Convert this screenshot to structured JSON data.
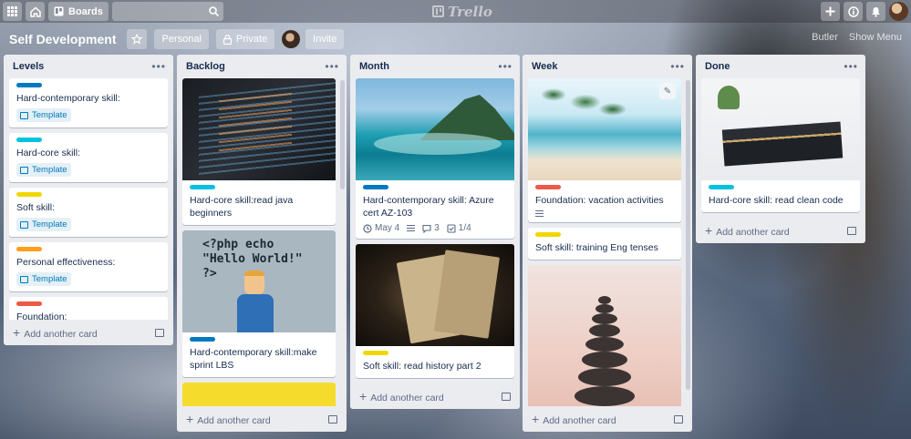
{
  "topbar": {
    "boards_label": "Boards",
    "logo_text": "Trello"
  },
  "board": {
    "title": "Self Development",
    "visibility_team": "Personal",
    "visibility_private": "Private",
    "invite_label": "Invite",
    "right_items": [
      "Butler",
      "Show Menu"
    ]
  },
  "colors": {
    "blue": "#0079bf",
    "sky": "#00c2e0",
    "yellow": "#f2d600",
    "orange": "#ff9f1a",
    "red": "#eb5a46"
  },
  "common": {
    "add_card_label": "Add another card",
    "template_badge": "Template"
  },
  "lists": {
    "levels": {
      "title": "Levels",
      "cards": [
        {
          "title": "Hard-contemporary skill:",
          "label_color": "blue"
        },
        {
          "title": "Hard-core skill:",
          "label_color": "sky"
        },
        {
          "title": "Soft skill:",
          "label_color": "yellow"
        },
        {
          "title": "Personal effectiveness:",
          "label_color": "orange"
        },
        {
          "title": "Foundation:",
          "label_color": "red"
        }
      ]
    },
    "backlog": {
      "title": "Backlog",
      "cards": [
        {
          "title": "Hard-core skill:read java beginners",
          "label_color": "sky"
        },
        {
          "title": "Hard-contemporary skill:make sprint LBS",
          "label_color": "blue"
        }
      ],
      "cover_text": [
        "<?php echo",
        "\"Hello World!\"",
        "?>"
      ]
    },
    "month": {
      "title": "Month",
      "cards": [
        {
          "title": "Hard-contemporary skill: Azure cert AZ-103",
          "label_color": "blue",
          "due": "May 4",
          "comments": "3",
          "checklist": "1/4"
        },
        {
          "title": "Soft skill: read history part 2",
          "label_color": "yellow"
        }
      ]
    },
    "week": {
      "title": "Week",
      "cards": [
        {
          "title": "Foundation: vacation activities",
          "label_color": "red"
        },
        {
          "title": "Soft skill: training Eng tenses",
          "label_color": "yellow"
        }
      ]
    },
    "done": {
      "title": "Done",
      "cards": [
        {
          "title": "Hard-core skill: read clean code",
          "label_color": "sky"
        }
      ]
    }
  }
}
